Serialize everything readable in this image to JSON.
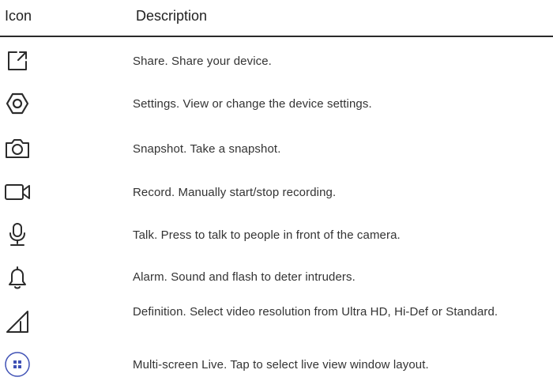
{
  "header": {
    "icon": "Icon",
    "description": "Description"
  },
  "rows": [
    {
      "icon": "share-icon",
      "text": "Share. Share your device."
    },
    {
      "icon": "settings-hex-icon",
      "text": "Settings. View or change the device settings."
    },
    {
      "icon": "camera-icon",
      "text": "Snapshot. Take a snapshot."
    },
    {
      "icon": "video-camera-icon",
      "text": "Record. Manually start/stop recording."
    },
    {
      "icon": "microphone-icon",
      "text": "Talk. Press to talk to people in front of the camera."
    },
    {
      "icon": "bell-icon",
      "text": "Alarm. Sound and flash to deter intruders."
    },
    {
      "icon": "signal-triangle-icon",
      "text": "Definition. Select video resolution from Ultra HD, Hi-Def or Standard."
    },
    {
      "icon": "multi-screen-icon",
      "text": "Multi-screen Live. Tap to select live view window layout."
    }
  ],
  "colors": {
    "icon_stroke": "#2b2b2b",
    "multiscreen_accent": "#3f51b5"
  }
}
